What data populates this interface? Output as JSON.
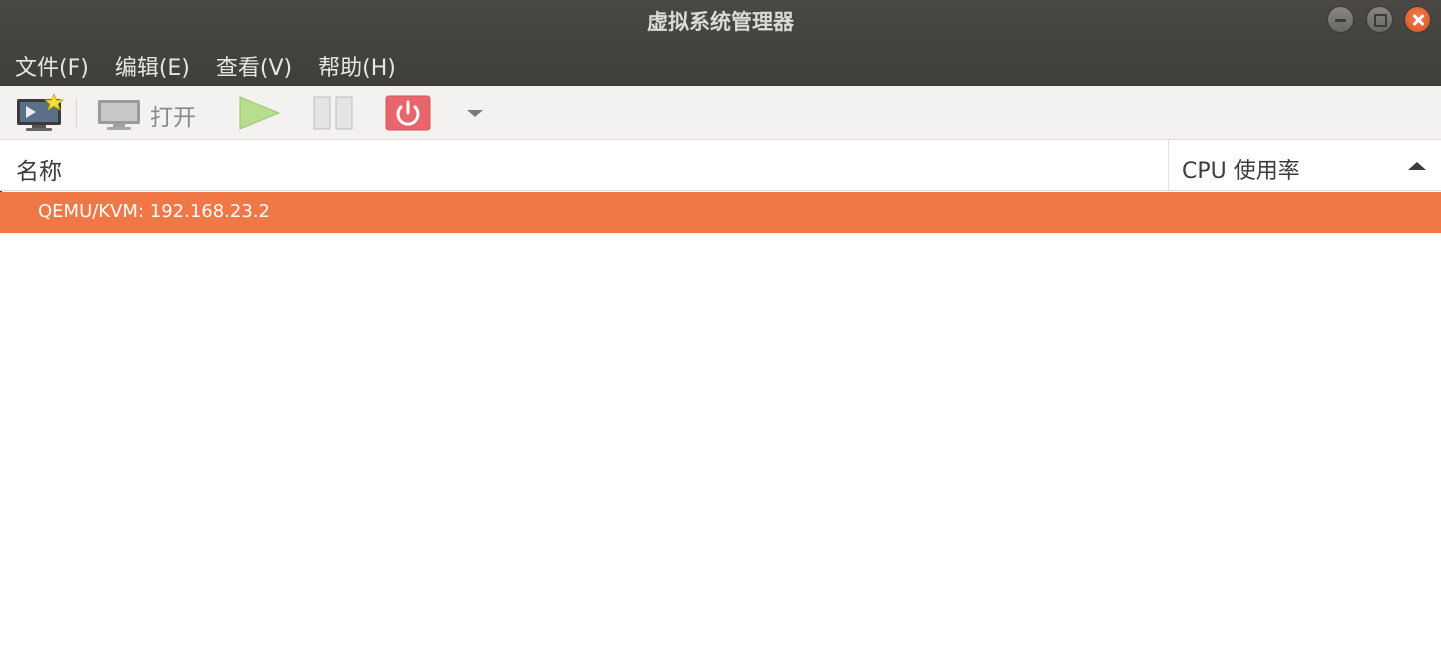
{
  "window": {
    "title": "虚拟系统管理器",
    "controls": [
      "minimize",
      "maximize",
      "close"
    ]
  },
  "menubar": {
    "items": [
      {
        "label": "文件(F)"
      },
      {
        "label": "编辑(E)"
      },
      {
        "label": "查看(V)"
      },
      {
        "label": "帮助(H)"
      }
    ]
  },
  "toolbar": {
    "new_vm_icon": "monitor-with-star-icon",
    "open_label": "打开",
    "open_icon": "monitor-icon",
    "run_icon": "play-icon",
    "pause_icon": "pause-icon",
    "shutdown_icon": "power-icon",
    "shutdown_menu_icon": "chevron-down-icon"
  },
  "list": {
    "columns": {
      "name": "名称",
      "cpu": "CPU 使用率"
    },
    "sort": "ascending",
    "rows": [
      {
        "label": "QEMU/KVM: 192.168.23.2",
        "selected": true
      }
    ]
  },
  "colors": {
    "header_bg": "#43413d",
    "selection": "#f07746",
    "close_button": "#e35d2a"
  }
}
